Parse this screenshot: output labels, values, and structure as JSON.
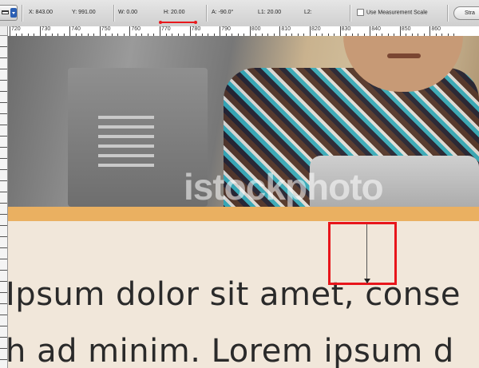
{
  "options_bar": {
    "tool_icon": "ruler-icon",
    "x": "X: 843.00",
    "y": "Y: 991.00",
    "w": "W: 0.00",
    "h": "H: 20.00",
    "a": "A: -90.0°",
    "l1": "L1: 20.00",
    "l2": "L2:",
    "use_measurement_scale": "Use Measurement Scale",
    "straighten_label": "Stra"
  },
  "ruler": {
    "labels": [
      "720",
      "730",
      "740",
      "750",
      "760",
      "770",
      "780",
      "790",
      "800",
      "810",
      "820",
      "830",
      "840",
      "850",
      "860"
    ]
  },
  "canvas": {
    "watermark": "istockphoto",
    "lorem_line_1": "Ipsum dolor sit amet, conse",
    "lorem_line_2": "h ad minim. Lorem ipsum d"
  },
  "measure_highlight_color": "#e8151b"
}
